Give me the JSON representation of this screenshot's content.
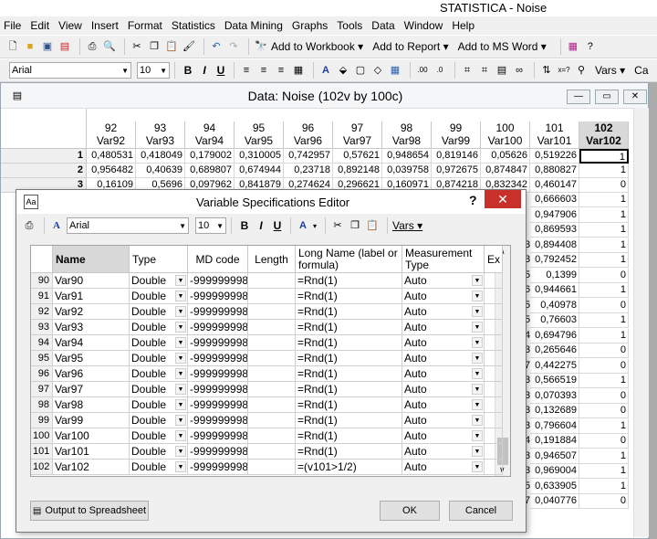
{
  "app_title": "STATISTICA - Noise",
  "menu": [
    "File",
    "Edit",
    "View",
    "Insert",
    "Format",
    "Statistics",
    "Data Mining",
    "Graphs",
    "Tools",
    "Data",
    "Window",
    "Help"
  ],
  "toolbar1": {
    "add_workbook": "Add to Workbook",
    "add_report": "Add to Report",
    "add_msword": "Add to MS Word"
  },
  "toolbar2": {
    "font": "Arial",
    "size": "10",
    "vars": "Vars",
    "cases": "Ca"
  },
  "data_window": {
    "title": "Data: Noise (102v by 100c)",
    "columns": [
      {
        "num": "92",
        "name": "Var92"
      },
      {
        "num": "93",
        "name": "Var93"
      },
      {
        "num": "94",
        "name": "Var94"
      },
      {
        "num": "95",
        "name": "Var95"
      },
      {
        "num": "96",
        "name": "Var96"
      },
      {
        "num": "97",
        "name": "Var97"
      },
      {
        "num": "98",
        "name": "Var98"
      },
      {
        "num": "99",
        "name": "Var99"
      },
      {
        "num": "100",
        "name": "Var100"
      },
      {
        "num": "101",
        "name": "Var101"
      },
      {
        "num": "102",
        "name": "Var102"
      }
    ],
    "rows": [
      {
        "n": "1",
        "v": [
          "0,480531",
          "0,418049",
          "0,179002",
          "0,310005",
          "0,742957",
          "0,57621",
          "0,948654",
          "0,819146",
          "0,05626",
          "0,519226",
          "1"
        ]
      },
      {
        "n": "2",
        "v": [
          "0,956482",
          "0,40639",
          "0,689807",
          "0,674944",
          "0,23718",
          "0,892148",
          "0,039758",
          "0,972675",
          "0,874847",
          "0,880827",
          "1"
        ]
      },
      {
        "n": "3",
        "v": [
          "0,16109",
          "0,5696",
          "0,097962",
          "0,841879",
          "0,274624",
          "0,296621",
          "0,160971",
          "0,874218",
          "0,832342",
          "0,460147",
          "0"
        ]
      }
    ],
    "peek_rows": [
      {
        "frag": "",
        "v101": "0,666603",
        "v102": "1"
      },
      {
        "frag": "",
        "v101": "0,947906",
        "v102": "1"
      },
      {
        "frag": "",
        "v101": "0,869593",
        "v102": "1"
      },
      {
        "frag": "3",
        "v101": "0,894408",
        "v102": "1"
      },
      {
        "frag": "3",
        "v101": "0,792452",
        "v102": "1"
      },
      {
        "frag": "5",
        "v101": "0,1399",
        "v102": "0"
      },
      {
        "frag": "6",
        "v101": "0,944661",
        "v102": "1"
      },
      {
        "frag": "5",
        "v101": "0,40978",
        "v102": "0"
      },
      {
        "frag": "5",
        "v101": "0,76603",
        "v102": "1"
      },
      {
        "frag": "4",
        "v101": "0,694796",
        "v102": "1"
      },
      {
        "frag": "3",
        "v101": "0,265646",
        "v102": "0"
      },
      {
        "frag": "7",
        "v101": "0,442275",
        "v102": "0"
      },
      {
        "frag": "3",
        "v101": "0,566519",
        "v102": "1"
      },
      {
        "frag": "3",
        "v101": "0,070393",
        "v102": "0"
      },
      {
        "frag": "3",
        "v101": "0,132689",
        "v102": "0"
      },
      {
        "frag": "3",
        "v101": "0,796604",
        "v102": "1"
      },
      {
        "frag": "4",
        "v101": "0,191884",
        "v102": "0"
      },
      {
        "frag": "3",
        "v101": "0,946507",
        "v102": "1"
      },
      {
        "frag": "3",
        "v101": "0,969004",
        "v102": "1"
      },
      {
        "frag": "5",
        "v101": "0,633905",
        "v102": "1"
      },
      {
        "frag": "7",
        "v101": "0,040776",
        "v102": "0"
      }
    ]
  },
  "dialog": {
    "title": "Variable Specifications Editor",
    "help": "?",
    "font": "Arial",
    "size": "10",
    "vars": "Vars",
    "headers": [
      "Name",
      "Type",
      "MD code",
      "Length",
      "Long Name (label or formula)",
      "Measurement Type",
      "Ex"
    ],
    "rows": [
      {
        "n": "90",
        "name": "Var90",
        "type": "Double",
        "md": "-999999998",
        "formula": "=Rnd(1)",
        "mtype": "Auto"
      },
      {
        "n": "91",
        "name": "Var91",
        "type": "Double",
        "md": "-999999998",
        "formula": "=Rnd(1)",
        "mtype": "Auto"
      },
      {
        "n": "92",
        "name": "Var92",
        "type": "Double",
        "md": "-999999998",
        "formula": "=Rnd(1)",
        "mtype": "Auto"
      },
      {
        "n": "93",
        "name": "Var93",
        "type": "Double",
        "md": "-999999998",
        "formula": "=Rnd(1)",
        "mtype": "Auto"
      },
      {
        "n": "94",
        "name": "Var94",
        "type": "Double",
        "md": "-999999998",
        "formula": "=Rnd(1)",
        "mtype": "Auto"
      },
      {
        "n": "95",
        "name": "Var95",
        "type": "Double",
        "md": "-999999998",
        "formula": "=Rnd(1)",
        "mtype": "Auto"
      },
      {
        "n": "96",
        "name": "Var96",
        "type": "Double",
        "md": "-999999998",
        "formula": "=Rnd(1)",
        "mtype": "Auto"
      },
      {
        "n": "97",
        "name": "Var97",
        "type": "Double",
        "md": "-999999998",
        "formula": "=Rnd(1)",
        "mtype": "Auto"
      },
      {
        "n": "98",
        "name": "Var98",
        "type": "Double",
        "md": "-999999998",
        "formula": "=Rnd(1)",
        "mtype": "Auto"
      },
      {
        "n": "99",
        "name": "Var99",
        "type": "Double",
        "md": "-999999998",
        "formula": "=Rnd(1)",
        "mtype": "Auto"
      },
      {
        "n": "100",
        "name": "Var100",
        "type": "Double",
        "md": "-999999998",
        "formula": "=Rnd(1)",
        "mtype": "Auto"
      },
      {
        "n": "101",
        "name": "Var101",
        "type": "Double",
        "md": "-999999998",
        "formula": "=Rnd(1)",
        "mtype": "Auto"
      },
      {
        "n": "102",
        "name": "Var102",
        "type": "Double",
        "md": "-999999998",
        "formula": "=(v101>1/2)",
        "mtype": "Auto"
      }
    ],
    "output_btn": "Output to Spreadsheet",
    "ok_btn": "OK",
    "cancel_btn": "Cancel"
  }
}
